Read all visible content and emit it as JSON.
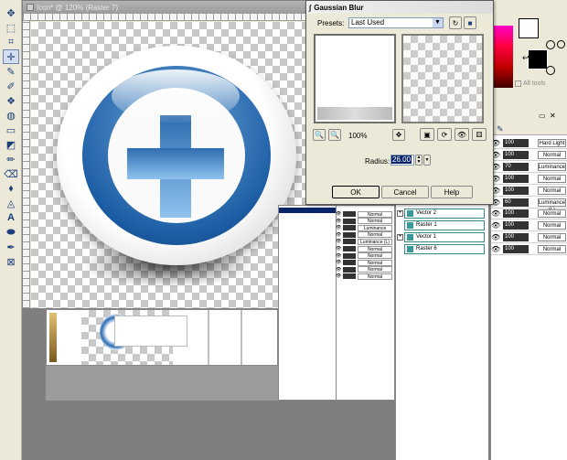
{
  "canvas_window": {
    "title": "Icon* @ 120% (Raster 7)"
  },
  "dialog": {
    "title": "Gaussian Blur",
    "presets_label": "Presets:",
    "presets_value": "Last Used",
    "zoom": "100%",
    "radius_label": "Radius:",
    "radius_value": "26.00",
    "ok": "OK",
    "cancel": "Cancel",
    "help": "Help"
  },
  "layers_right": [
    {
      "opacity": "100",
      "blend": "Hard Light"
    },
    {
      "opacity": "100",
      "blend": "Normal"
    },
    {
      "opacity": "70",
      "blend": "Luminance"
    },
    {
      "opacity": "100",
      "blend": "Normal"
    },
    {
      "opacity": "100",
      "blend": "Normal"
    },
    {
      "opacity": "60",
      "blend": "Luminance (L)"
    },
    {
      "opacity": "100",
      "blend": "Normal"
    },
    {
      "opacity": "100",
      "blend": "Normal"
    },
    {
      "opacity": "100",
      "blend": "Normal"
    },
    {
      "opacity": "100",
      "blend": "Normal"
    }
  ],
  "layer_names": [
    "Vector 2",
    "Raster 1",
    "Vector 1",
    "Raster 6"
  ],
  "mid_rows": [
    "Normal",
    "Normal",
    "Luminance",
    "Normal",
    "Luminance (L)",
    "Normal",
    "Normal",
    "Normal",
    "Normal",
    "Normal"
  ],
  "palette": {
    "all_tools": "All tools"
  },
  "colors": {
    "accent_blue": "#2a6cb3",
    "title_blue": "#0a246a",
    "panel": "#ece9d8"
  }
}
